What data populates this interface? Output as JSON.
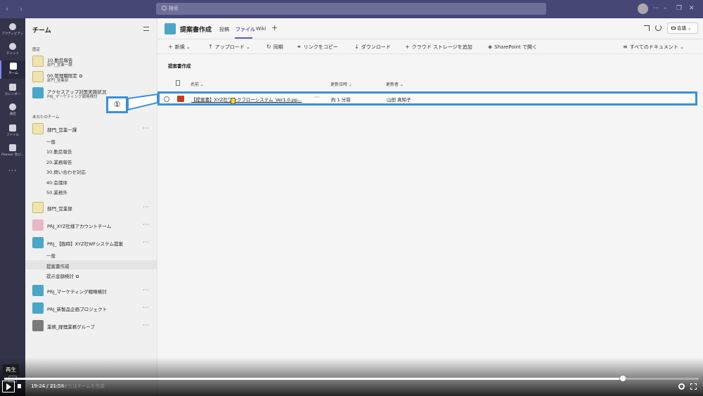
{
  "search": {
    "placeholder": "検索"
  },
  "rail": [
    {
      "label": "アクティビティ",
      "icon": "bell-icon"
    },
    {
      "label": "チャット",
      "icon": "chat-icon"
    },
    {
      "label": "チーム",
      "icon": "teams-icon"
    },
    {
      "label": "カレンダー",
      "icon": "calendar-icon"
    },
    {
      "label": "通話",
      "icon": "phone-icon"
    },
    {
      "label": "ファイル",
      "icon": "file-icon"
    },
    {
      "label": "Planner 及び...",
      "icon": "planner-icon"
    }
  ],
  "teams_panel": {
    "title": "チーム",
    "pinned_label": "固定",
    "pinned": [
      {
        "name": "10.勤怠報告",
        "sub": "部門_営業一課"
      },
      {
        "name": "00.管理職限定",
        "sub": "部門_営業部"
      },
      {
        "name": "アクセスアップ対策実施状況",
        "sub": "PRJ_マーケティング戦略検討"
      }
    ],
    "yours_label": "あなたのチーム",
    "team1": {
      "name": "部門_営業一課",
      "channels": [
        "一般",
        "10.勤怠報告",
        "20.業務報告",
        "30.問い合わせ対応",
        "40.会議体",
        "50.業務外"
      ]
    },
    "team2": {
      "name": "部門_営業部"
    },
    "team3": {
      "name": "PRJ_XYZ社様アカウントチーム"
    },
    "team4": {
      "name": "PRJ_【臨時】XYZ社WFシステム提案",
      "channels": [
        "一般",
        "提案書作成",
        "提示金額検討"
      ]
    },
    "team5": {
      "name": "PRJ_マーケティング戦略検討"
    },
    "team6": {
      "name": "PRJ_新製品企画プロジェクト"
    },
    "team7": {
      "name": "業務_経理業務グループ"
    }
  },
  "header": {
    "channel_title": "提案書作成",
    "tabs": [
      "投稿",
      "ファイル",
      "Wiki"
    ],
    "active_tab": "ファイル",
    "meet_label": "会議"
  },
  "toolbar": {
    "new": "新規",
    "upload": "アップロード",
    "sync": "同期",
    "copy_link": "リンクをコピー",
    "download": "ダウンロード",
    "add_storage": "クラウド ストレージを追加",
    "open_sharepoint": "SharePoint で開く",
    "all_docs": "すべてのドキュメント"
  },
  "library": {
    "title": "提案書作成",
    "columns": {
      "name": "名前",
      "modified": "更新日時",
      "modified_by": "更新者"
    },
    "files": [
      {
        "name": "【提案書】XYZ社ワークフローシステム_Ver1.0.pp...",
        "modified": "約 1 分前",
        "modified_by": "山田 真知子",
        "icon": "pptx-icon"
      }
    ]
  },
  "callout": {
    "label": "①"
  },
  "video": {
    "tooltip": "再生",
    "time": "19:24 / 21:58",
    "progress": 0.886,
    "ghost_text": "チームに参加、またはチームを作成"
  },
  "colors": {
    "titlebar": "#464775",
    "rail": "#33344a",
    "accent": "#5b5fc7",
    "callout": "#3d8fd6"
  }
}
